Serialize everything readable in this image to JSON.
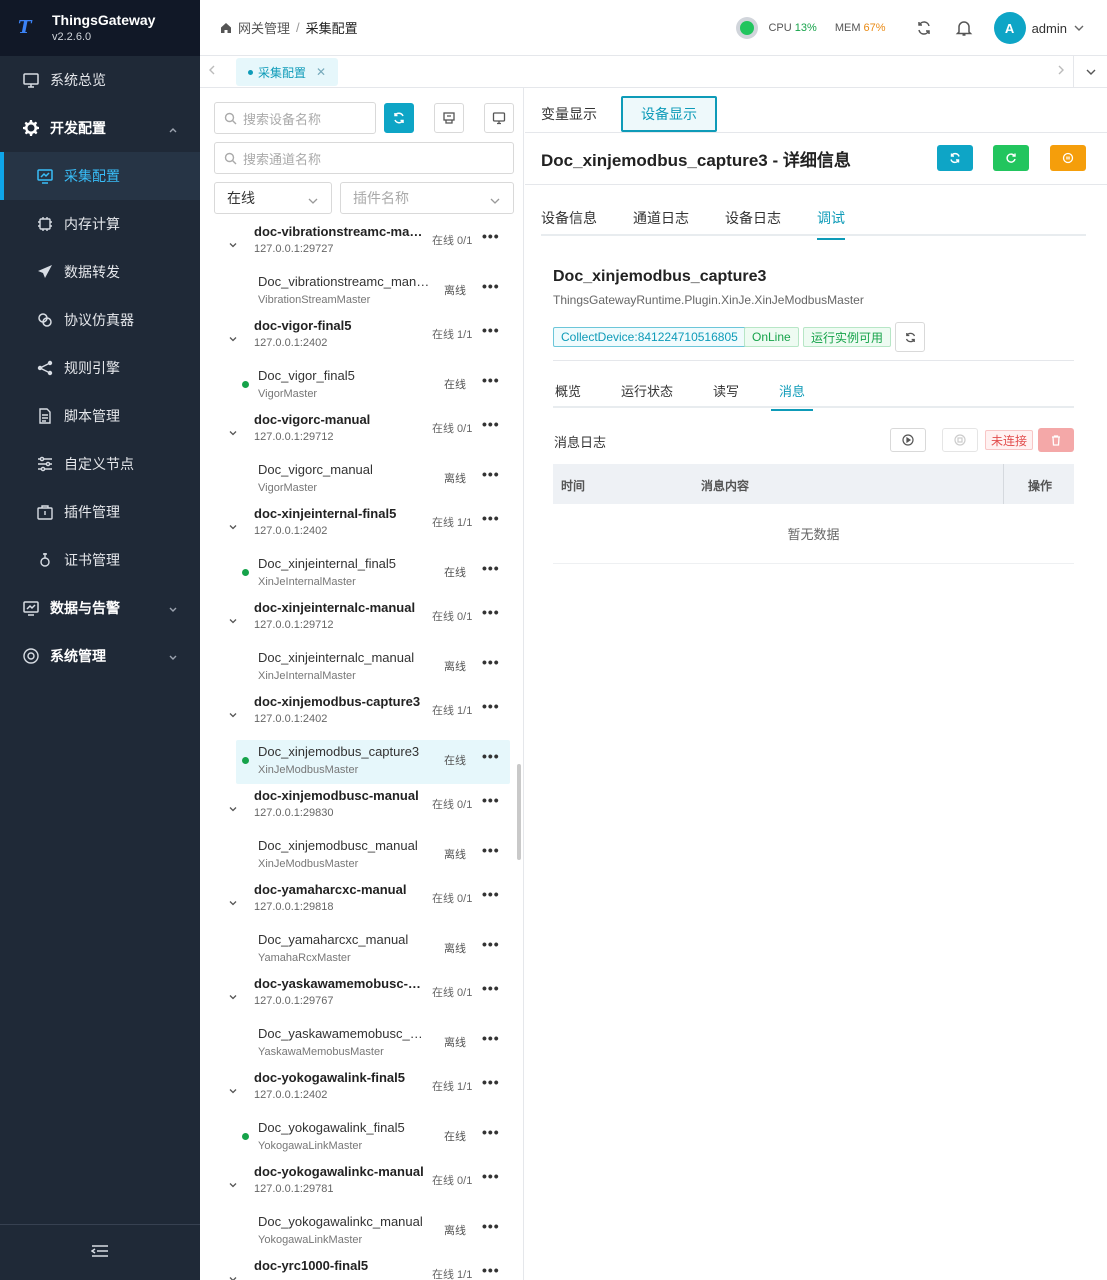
{
  "app": {
    "name": "ThingsGateway",
    "version": "v2.2.6.0"
  },
  "sidebar": {
    "items": [
      {
        "label": "系统总览",
        "icon": "monitor-icon"
      },
      {
        "label": "开发配置",
        "icon": "gear-icon"
      },
      {
        "label": "采集配置",
        "icon": "chart-monitor-icon"
      },
      {
        "label": "内存计算",
        "icon": "chip-icon"
      },
      {
        "label": "数据转发",
        "icon": "send-icon"
      },
      {
        "label": "协议仿真器",
        "icon": "link-icon"
      },
      {
        "label": "规则引擎",
        "icon": "share-icon"
      },
      {
        "label": "脚本管理",
        "icon": "document-icon"
      },
      {
        "label": "自定义节点",
        "icon": "sliders-icon"
      },
      {
        "label": "插件管理",
        "icon": "package-icon"
      },
      {
        "label": "证书管理",
        "icon": "certificate-icon"
      },
      {
        "label": "数据与告警",
        "icon": "chart-monitor-icon"
      },
      {
        "label": "系统管理",
        "icon": "gear-icon"
      }
    ]
  },
  "header": {
    "breadcrumb": [
      "网关管理",
      "采集配置"
    ],
    "cpu_label": "CPU",
    "cpu_value": "13%",
    "mem_label": "MEM",
    "mem_value": "67%",
    "user_initial": "A",
    "user_name": "admin"
  },
  "tabstrip": {
    "tab_label": "采集配置"
  },
  "left": {
    "search_device_placeholder": "搜索设备名称",
    "search_channel_placeholder": "搜索通道名称",
    "status_select": "在线",
    "plugin_select_placeholder": "插件名称",
    "channels": [
      {
        "name": "doc-vibrationstreamc-man...",
        "addr": "127.0.0.1:29727",
        "status": "在线 0/1",
        "device": {
          "name": "Doc_vibrationstreamc_manual",
          "driver": "VibrationStreamMaster",
          "status": "离线",
          "online": false
        }
      },
      {
        "name": "doc-vigor-final5",
        "addr": "127.0.0.1:2402",
        "status": "在线 1/1",
        "device": {
          "name": "Doc_vigor_final5",
          "driver": "VigorMaster",
          "status": "在线",
          "online": true
        }
      },
      {
        "name": "doc-vigorc-manual",
        "addr": "127.0.0.1:29712",
        "status": "在线 0/1",
        "device": {
          "name": "Doc_vigorc_manual",
          "driver": "VigorMaster",
          "status": "离线",
          "online": false
        }
      },
      {
        "name": "doc-xinjeinternal-final5",
        "addr": "127.0.0.1:2402",
        "status": "在线 1/1",
        "device": {
          "name": "Doc_xinjeinternal_final5",
          "driver": "XinJeInternalMaster",
          "status": "在线",
          "online": true
        }
      },
      {
        "name": "doc-xinjeinternalc-manual",
        "addr": "127.0.0.1:29712",
        "status": "在线 0/1",
        "device": {
          "name": "Doc_xinjeinternalc_manual",
          "driver": "XinJeInternalMaster",
          "status": "离线",
          "online": false
        }
      },
      {
        "name": "doc-xinjemodbus-capture3",
        "addr": "127.0.0.1:2402",
        "status": "在线 1/1",
        "device": {
          "name": "Doc_xinjemodbus_capture3",
          "driver": "XinJeModbusMaster",
          "status": "在线",
          "online": true,
          "selected": true
        }
      },
      {
        "name": "doc-xinjemodbusc-manual",
        "addr": "127.0.0.1:29830",
        "status": "在线 0/1",
        "device": {
          "name": "Doc_xinjemodbusc_manual",
          "driver": "XinJeModbusMaster",
          "status": "离线",
          "online": false
        }
      },
      {
        "name": "doc-yamaharcxc-manual",
        "addr": "127.0.0.1:29818",
        "status": "在线 0/1",
        "device": {
          "name": "Doc_yamaharcxc_manual",
          "driver": "YamahaRcxMaster",
          "status": "离线",
          "online": false
        }
      },
      {
        "name": "doc-yaskawamemobusc-m...",
        "addr": "127.0.0.1:29767",
        "status": "在线 0/1",
        "device": {
          "name": "Doc_yaskawamemobusc_ma...",
          "driver": "YaskawaMemobusMaster",
          "status": "离线",
          "online": false
        }
      },
      {
        "name": "doc-yokogawalink-final5",
        "addr": "127.0.0.1:2402",
        "status": "在线 1/1",
        "device": {
          "name": "Doc_yokogawalink_final5",
          "driver": "YokogawaLinkMaster",
          "status": "在线",
          "online": true
        }
      },
      {
        "name": "doc-yokogawalinkc-manual",
        "addr": "127.0.0.1:29781",
        "status": "在线 0/1",
        "device": {
          "name": "Doc_yokogawalinkc_manual",
          "driver": "YokogawaLinkMaster",
          "status": "离线",
          "online": false
        }
      },
      {
        "name": "doc-yrc1000-final5",
        "addr": "",
        "status": "在线 1/1",
        "device": null
      }
    ]
  },
  "right": {
    "top_tabs": [
      "变量显示",
      "设备显示"
    ],
    "title": "Doc_xinjemodbus_capture3 - 详细信息",
    "sub_tabs": [
      "设备信息",
      "通道日志",
      "设备日志",
      "调试"
    ],
    "device_name": "Doc_xinjemodbus_capture3",
    "plugin": "ThingsGatewayRuntime.Plugin.XinJe.XinJeModbusMaster",
    "tags": [
      "CollectDevice:841224710516805",
      "OnLine",
      "运行实例可用"
    ],
    "inner_tabs": [
      "概览",
      "运行状态",
      "读写",
      "消息"
    ],
    "log_label": "消息日志",
    "conn_status": "未连接",
    "table": {
      "col_time": "时间",
      "col_content": "消息内容",
      "col_action": "操作",
      "empty": "暂无数据"
    }
  },
  "colors": {
    "accent": "#0ea5c6",
    "sidebar_bg": "#1f2937",
    "online_green": "#16a34a",
    "warn_orange": "#f59e0b",
    "danger_red": "#e24d4d"
  }
}
